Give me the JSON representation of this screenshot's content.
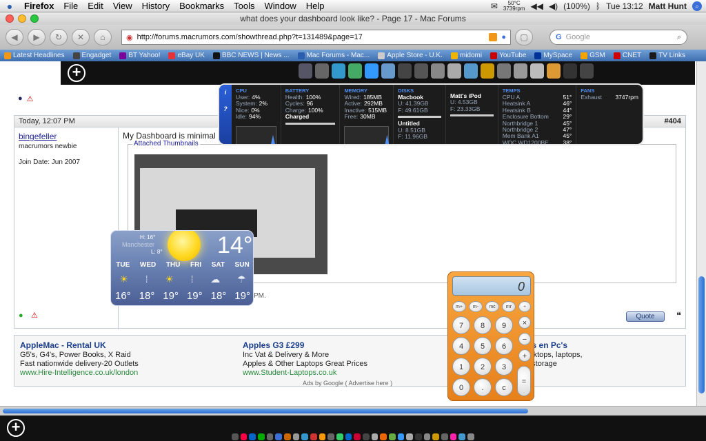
{
  "menubar": {
    "apple": "",
    "app": "Firefox",
    "items": [
      "File",
      "Edit",
      "View",
      "History",
      "Bookmarks",
      "Tools",
      "Window",
      "Help"
    ],
    "temp": "50°C",
    "rpm": "3739rpm",
    "battery": "(100%)",
    "clock": "Tue 13:12",
    "user": "Matt Hunt"
  },
  "window": {
    "title": "what does your dashboard look like? - Page 17 - Mac Forums"
  },
  "toolbar": {
    "url": "http://forums.macrumors.com/showthread.php?t=131489&page=17",
    "search_placeholder": "Google"
  },
  "bookmarks": [
    {
      "label": "Latest Headlines",
      "color": "#f29618"
    },
    {
      "label": "Engadget",
      "color": "#444444"
    },
    {
      "label": "BT Yahoo!",
      "color": "#7b0099"
    },
    {
      "label": "eBay UK",
      "color": "#e53238"
    },
    {
      "label": "BBC NEWS | News ...",
      "color": "#111111"
    },
    {
      "label": "Mac Forums - Mac...",
      "color": "#2a5db0"
    },
    {
      "label": "Apple Store - U.K.",
      "color": "#cccccc"
    },
    {
      "label": "midomi",
      "color": "#f0b400"
    },
    {
      "label": "YouTube",
      "color": "#cc0000"
    },
    {
      "label": "MySpace",
      "color": "#003399"
    },
    {
      "label": "GSM",
      "color": "#f4a300"
    },
    {
      "label": "CNET",
      "color": "#cc0000"
    },
    {
      "label": "TV Links",
      "color": "#1a1a1a"
    }
  ],
  "stats": {
    "cpu": {
      "title": "CPU",
      "user": "4%",
      "system": "2%",
      "nice": "0%",
      "idle": "94%"
    },
    "battery": {
      "title": "BATTERY",
      "health": "100%",
      "cycles": "96",
      "charge": "100%",
      "status": "Charged"
    },
    "memory": {
      "title": "MEMORY",
      "wired": "185MB",
      "active": "292MB",
      "inactive": "515MB",
      "free": "30MB"
    },
    "disks": {
      "title": "DISKS",
      "d1": "Macbook",
      "d1u": "U: 41.39GB",
      "d1f": "F: 49.61GB",
      "d2": "Untitled",
      "d2u": "U: 8.51GB",
      "d2f": "F: 11.96GB",
      "d3": "Matt's iPod",
      "d3u": "U: 4.53GB",
      "d3f": "F: 23.33GB"
    },
    "temps": {
      "title": "TEMPS",
      "items": [
        {
          "n": "CPU A",
          "v": "51°"
        },
        {
          "n": "Heatsink A",
          "v": "46°"
        },
        {
          "n": "Heatsink B",
          "v": "44°"
        },
        {
          "n": "Enclosure Bottom",
          "v": "29°"
        },
        {
          "n": "Northbridge 1",
          "v": "45°"
        },
        {
          "n": "Northbridge 2",
          "v": "47°"
        },
        {
          "n": "Mem Bank A1",
          "v": "45°"
        },
        {
          "n": "WDC WD1200BE...",
          "v": "38°"
        }
      ]
    },
    "fans": {
      "title": "FANS",
      "name": "Exhaust",
      "rpm": "3747rpm"
    }
  },
  "post": {
    "date": "Today, 12:07 PM",
    "number": "#404",
    "username": "bingefeller",
    "rank": "macrumors newbie",
    "joined": "Join Date: Jun 2007",
    "message": "My Dashboard is minimal",
    "attached": "Attached Thumbnails",
    "tail": "PM.",
    "quote": "Quote"
  },
  "weather": {
    "high": "H: 16°",
    "low": "L: 8°",
    "city": "Manchester",
    "temp": "14°",
    "days": [
      "TUE",
      "WED",
      "THU",
      "FRI",
      "SAT",
      "SUN"
    ],
    "icons": [
      "☀",
      "⁞",
      "☀",
      "⁞",
      "☁",
      "☂"
    ],
    "temps": [
      "16°",
      "18°",
      "19°",
      "19°",
      "18°",
      "19°"
    ]
  },
  "calc": {
    "display": "0",
    "mem": [
      "m+",
      "m-",
      "mc",
      "mr"
    ],
    "ops": [
      "÷",
      "×",
      "−",
      "+",
      "="
    ],
    "digits": [
      "7",
      "8",
      "9",
      "4",
      "5",
      "6",
      "1",
      "2",
      "3",
      "0",
      ".",
      "c"
    ]
  },
  "ads": [
    {
      "title": "AppleMac - Rental UK",
      "l1": "G5's, G4's, Power Books, X Raid",
      "l2": "Fast nationwide delivery-20 Outlets",
      "url": "www.Hire-Intelligence.co.uk/london"
    },
    {
      "title": "Apples G3 £299",
      "l1": "Inc Vat & Delivery & More",
      "l2": "Apples & Other Laptops Great Prices",
      "url": "www.Student-Laptops.co.uk"
    },
    {
      "title": "c's en Pc's",
      "l1": "esktops, laptops,",
      "l2": "n storage",
      "url": ""
    }
  ],
  "adsby": "Ads by Google ( Advertise here )"
}
